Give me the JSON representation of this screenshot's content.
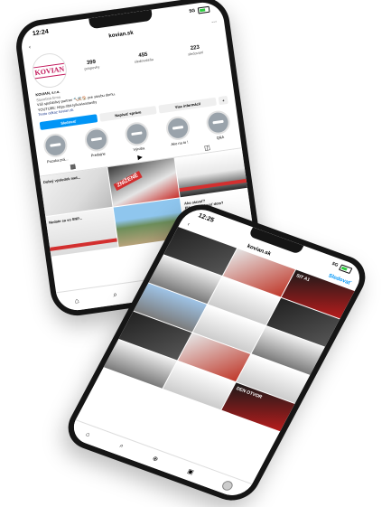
{
  "phone1": {
    "status": {
      "time": "12:24",
      "network": "5G"
    },
    "topbar": {
      "back_icon": "back-arrow-icon",
      "username": "kovian.sk",
      "menu_icon": "more-icon"
    },
    "profile": {
      "logo_text": "KOVIAN",
      "stats": [
        {
          "value": "399",
          "label": "príspevky"
        },
        {
          "value": "455",
          "label": "sledovatelia"
        },
        {
          "value": "223",
          "label": "sledovaní"
        }
      ],
      "name": "KOVIAN, s.r.o.",
      "category": "Stavebná firma",
      "bio_line1": "Váš spoľahlivý partner 🔨⚒️🏠 pre stavbu domu.",
      "bio_line2": "YOUTUBE: https://bit.ly/kovianstavby",
      "link": "Tento odkaz kovian.sk"
    },
    "buttons": {
      "follow": "Sledovať",
      "message": "Napísať správu",
      "contact": "Viac informácií",
      "more": "+"
    },
    "highlights": [
      "Pozuka prá...",
      "Predajne",
      "Výroba",
      "Ako na to !",
      "Q&A"
    ],
    "tiles": {
      "t1": "Dobrý výsledok nad...",
      "t2_stamp": "ZNÍŽENÉ",
      "t4": "Nedate sa vo SNP...",
      "t6_a": "Ako stavať?",
      "t6_b": "Plánujete stavať dom?"
    },
    "nav_icons": [
      "home-icon",
      "search-icon",
      "add-icon",
      "reels-icon",
      "profile-icon"
    ]
  },
  "phone2": {
    "status": {
      "time": "12:25",
      "network": "5G"
    },
    "topbar": {
      "username": "kovian.sk",
      "follow": "Sledovať"
    },
    "tiles": [
      "",
      "",
      "SIT A1",
      "",
      "",
      "",
      "",
      "",
      "",
      "",
      "",
      "",
      "",
      "",
      "DEN OTVOR"
    ]
  }
}
